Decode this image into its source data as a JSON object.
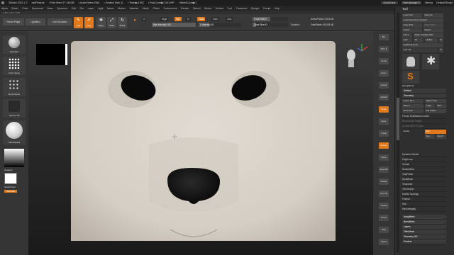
{
  "titlebar": {
    "items": [
      "ZBrush 2021.1.2",
      "wolfTexture",
      "• Free Mem 27.144GB",
      "• Active Mem 6344",
      "• Scratch Disk 41",
      "• Timer▶0.002",
      "• PolyCount▶0.514 MP",
      "• MeshCount▶1"
    ],
    "quicksave": "QuickSave",
    "seethrough": "See-through 0",
    "menus": "Menus",
    "script": "DefaultZScript"
  },
  "menubar": [
    "Alpha",
    "Brush",
    "Color",
    "Document",
    "Draw",
    "Dynamics",
    "Edit",
    "File",
    "Layer",
    "Light",
    "Macro",
    "Marker",
    "Material",
    "Movie",
    "Picker",
    "Preferences",
    "Render",
    "Stencil",
    "Stroke",
    "Texture",
    "Tool",
    "Transform",
    "Zplugin",
    "Zscript",
    "Help"
  ],
  "subbar": "0.351, 0.38, 0.536",
  "shelf": {
    "home": "Home Page",
    "lightbox": "LightBox",
    "live_boolean": "Live Boolean",
    "edit": "Edit",
    "draw": "Draw",
    "move": "Move",
    "scale": "Scale",
    "rotate": "Rotate",
    "a_label": "A",
    "mrgb": "Mrgb",
    "rgb": "Rgb",
    "m": "M",
    "zadd": "Zadd",
    "zsub": "Zsub",
    "zcut": "Zcut",
    "rgb_intensity": "Rgb Intensity 100",
    "z_intensity": "Z Intensity 25",
    "focal_shift": "Focal Shift 0",
    "draw_size": "Draw Size 91",
    "dynamic": "Dynamic",
    "active_points": "ActivePoints: 0.513 Mil",
    "total_points": "TotalPoints: 98.033 Mil"
  },
  "leftshelf": {
    "brush": "Standard",
    "stroke": "Color Spray",
    "alpha": "Brush Alpha",
    "texture": "Texture Off",
    "material": "SkinShade4",
    "gradient": "Gradient",
    "switch": "SwitchColor",
    "alternate": "Alternate"
  },
  "rightshelf": [
    "Bpr",
    "SPix 3",
    "Scroll",
    "Zoom",
    "Actual",
    "AAHalf",
    "Persp",
    "Floor",
    "Local",
    "Frame",
    "Move",
    "Zoom3D",
    "Rotate",
    "Line Fill",
    "Transp",
    "Ghost",
    "Solo",
    "Xpose"
  ],
  "tray": {
    "title": "Tool",
    "load_tool": "Load Tool",
    "save_as": "Save As",
    "load_from_project": "Load Tools From Project",
    "copy_tool": "Copy Tool",
    "paste_tool": "Paste Tool",
    "import": "Import",
    "export": "Export",
    "clone": "Clone",
    "make_polymesh": "Make PolyMesh3D",
    "goz": "GoZ",
    "all": "All",
    "visible": "Visible",
    "r": "R",
    "lightbox_tools": "Lightbox▸Tools",
    "tool_name": "wolf. 48",
    "r2": "R",
    "simple_brush": "SimpleBrush",
    "subtool": "Subtool",
    "geometry": "Geometry",
    "lower_res": "Lower Res",
    "higher_res": "Higher Res",
    "sdiv": "SDiv 5",
    "cage": "Cage",
    "rstr": "Rstr",
    "del_lower": "Del Lower",
    "del_higher": "Del Higher",
    "freeze": "Freeze SubDivision Levels",
    "reconstruct": "Reconstruct Subdiv",
    "convert_bpr": "Convert BPR To Geo",
    "divide": "Divide",
    "smt": "Smt",
    "suv": "Suv",
    "reuv": "ReUV",
    "dynamic_subdiv": "Dynamic Subdiv",
    "edgeloop": "EdgeLoop",
    "crease": "Crease",
    "shadowbox": "ShadowBox",
    "claypolish": "ClayPolish",
    "dynamesh": "DynaMesh",
    "tessimate": "Tessimate",
    "zremesher": "ZRemesher",
    "modify_topology": "Modify Topology",
    "position": "Position",
    "size": "Size",
    "meshintegrity": "MeshIntegrity",
    "arraymesh": "ArrayMesh",
    "nanomesh": "NanoMesh",
    "layers": "Layers",
    "fibermesh": "FiberMesh",
    "geometry_hd": "Geometry HD",
    "preview": "Preview"
  },
  "colors": {
    "accent": "#e0781c",
    "panel": "#353535",
    "sculpt": "#d9d3cb"
  },
  "icons": [
    "close-icon",
    "tool-draw-icon",
    "move-icon",
    "scale-icon",
    "rotate-icon",
    "head-nav-icon",
    "axis-icon",
    "sphere-icon"
  ]
}
